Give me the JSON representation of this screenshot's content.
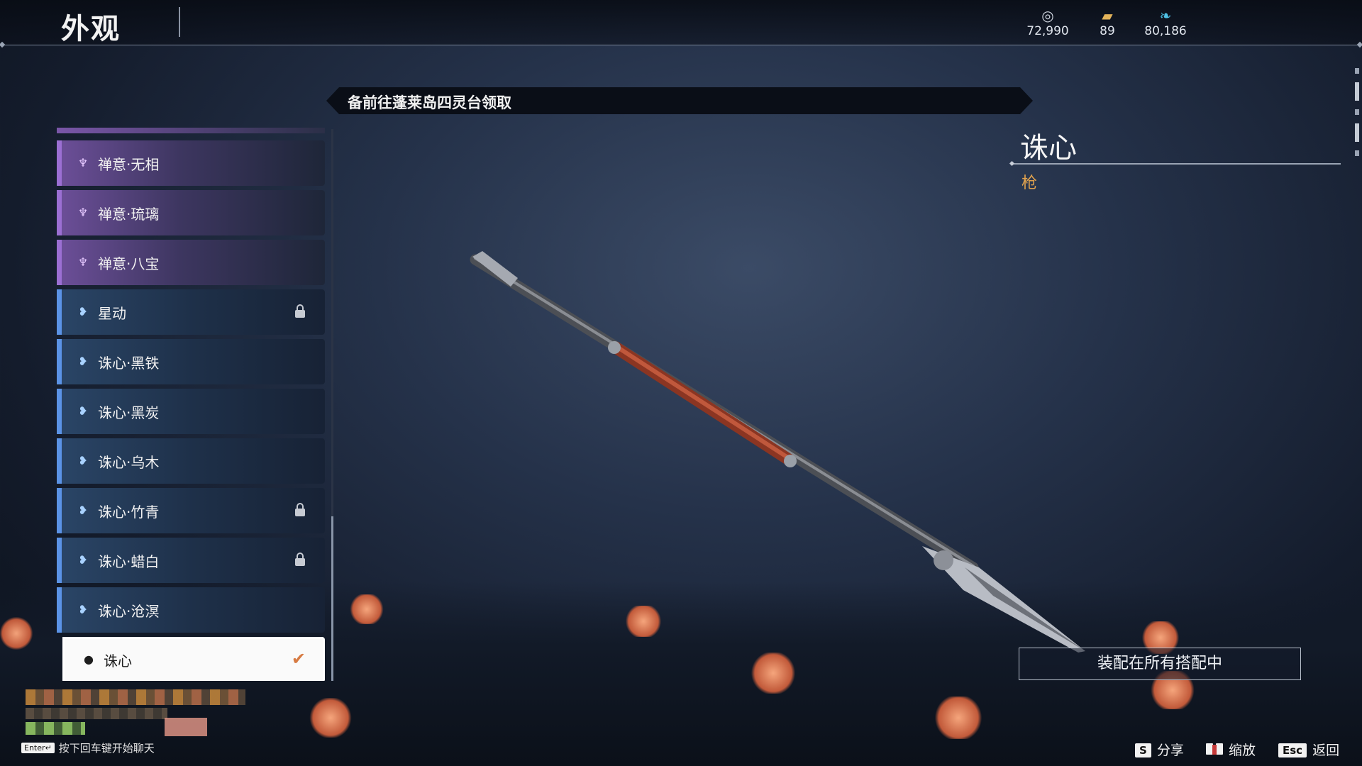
{
  "header": {
    "title": "外观",
    "currencies": [
      {
        "icon": "coin-icon",
        "value": "72,990"
      },
      {
        "icon": "ticket-icon",
        "value": "89"
      },
      {
        "icon": "feather-icon",
        "value": "80,186"
      }
    ]
  },
  "banner": {
    "text": "备前往蓬莱岛四灵台领取"
  },
  "skin_list": [
    {
      "label": "禅意·无相",
      "rarity": "purple",
      "locked": false
    },
    {
      "label": "禅意·琉璃",
      "rarity": "purple",
      "locked": false
    },
    {
      "label": "禅意·八宝",
      "rarity": "purple",
      "locked": false
    },
    {
      "label": "星动",
      "rarity": "blue",
      "locked": true
    },
    {
      "label": "诛心·黑铁",
      "rarity": "blue",
      "locked": false
    },
    {
      "label": "诛心·黑炭",
      "rarity": "blue",
      "locked": false
    },
    {
      "label": "诛心·乌木",
      "rarity": "blue",
      "locked": false
    },
    {
      "label": "诛心·竹青",
      "rarity": "blue",
      "locked": true
    },
    {
      "label": "诛心·蜡白",
      "rarity": "blue",
      "locked": true
    },
    {
      "label": "诛心·沧溟",
      "rarity": "blue",
      "locked": false
    },
    {
      "label": "诛心",
      "rarity": "white",
      "selected": true
    }
  ],
  "detail": {
    "name": "诛心",
    "type": "枪",
    "equip_label": "装配在所有搭配中"
  },
  "chat": {
    "key": "Enter↵",
    "hint": "按下回车键开始聊天"
  },
  "hotkeys": [
    {
      "key": "S",
      "label": "分享"
    },
    {
      "key": "book",
      "label": "缩放"
    },
    {
      "key": "Esc",
      "label": "返回"
    }
  ],
  "colors": {
    "accent_orange": "#e0a24e",
    "purple": "#9b6fd3",
    "blue": "#5b93e6"
  }
}
